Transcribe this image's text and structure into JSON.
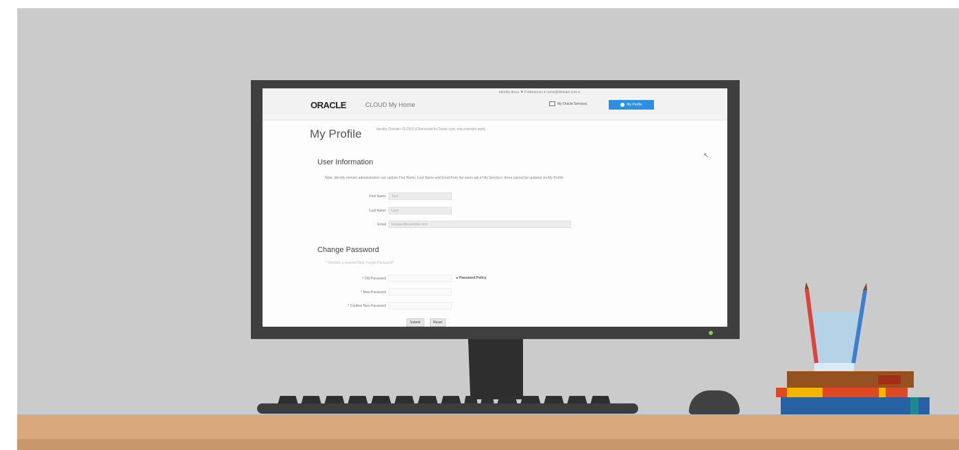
{
  "app": {
    "logo": "ORACLE",
    "logo_sub": "CLOUD My Home",
    "topbar_links": "identity-dea ▸ ⚑ Preferences ▾ name@domain.com ▾",
    "dashboard_button": "My Oracle Services",
    "profile_button": "My Profile"
  },
  "page": {
    "title": "My Profile",
    "subtitle": "Identity Domain: CLOUD (Connected to Oracle.com, one.example.com)"
  },
  "user_info": {
    "heading": "User Information",
    "note": "Note: Identity domain administrators can update First Name, Last Name and Email from the users tab of My Services; these cannot be updated via My Profile.",
    "first_name_label": "First Name",
    "first_name_value": "Test",
    "last_name_label": "Last Name",
    "last_name_value": "User",
    "email_label": "Email",
    "email_value": "testuser@example.com"
  },
  "change_password": {
    "heading": "Change Password",
    "hint": "* Denotes a required field. Forgot Password?",
    "old_label": "* Old Password",
    "new_label": "* New Password",
    "confirm_label": "* Confirm New Password",
    "policy_link": "▸ Password Policy",
    "submit_label": "Submit",
    "reset_label": "Reset"
  },
  "colors": {
    "wall": "#cbcbcb",
    "desk": "#d9a87c",
    "monitor": "#3f3f3f",
    "accent": "#2e8fe0",
    "power_led": "#8ad14b"
  }
}
